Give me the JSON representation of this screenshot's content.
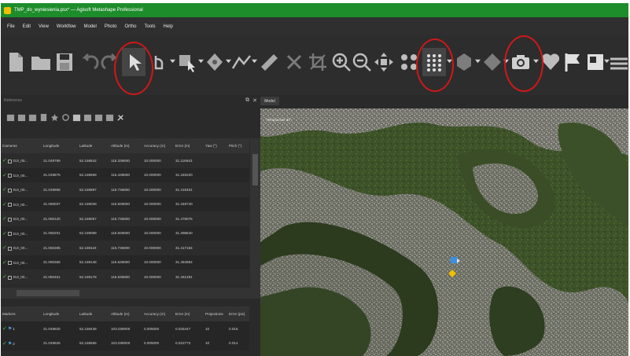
{
  "window": {
    "title": "TMP_do_wyniesienia.psx* — Agisoft Metashape Professional"
  },
  "menu": [
    "File",
    "Edit",
    "View",
    "Workflow",
    "Model",
    "Photo",
    "Ortho",
    "Tools",
    "Help"
  ],
  "toolbar": {
    "buttons": [
      {
        "name": "new-document-icon"
      },
      {
        "name": "open-folder-icon"
      },
      {
        "name": "save-icon"
      },
      {
        "name": "undo-icon"
      },
      {
        "name": "redo-icon"
      },
      {
        "name": "navigation-pointer-icon"
      },
      {
        "name": "rotate-object-icon"
      },
      {
        "name": "rectangle-selection-icon"
      },
      {
        "name": "draw-point-icon"
      },
      {
        "name": "draw-polyline-icon"
      },
      {
        "name": "ruler-icon"
      },
      {
        "name": "delete-selection-icon"
      },
      {
        "name": "crop-selection-icon"
      },
      {
        "name": "zoom-in-icon"
      },
      {
        "name": "zoom-out-icon"
      },
      {
        "name": "move-object-icon"
      },
      {
        "name": "tie-points-icon"
      },
      {
        "name": "dense-cloud-icon"
      },
      {
        "name": "model-shaded-icon"
      },
      {
        "name": "tiled-model-icon"
      },
      {
        "name": "show-cameras-icon"
      },
      {
        "name": "show-markers-icon"
      },
      {
        "name": "show-shapes-icon"
      },
      {
        "name": "show-images-icon"
      },
      {
        "name": "show-layers-icon"
      }
    ],
    "accent_circle_color": "#d01818"
  },
  "reference": {
    "panel_label": "Reference",
    "cameras": {
      "headers": [
        "Cameras",
        "Longitude",
        "Latitude",
        "Altitude (m)",
        "Accuracy (m)",
        "Error (m)",
        "Yaw (°)",
        "Pitch (°)"
      ],
      "rows": [
        {
          "label": "DJI_00...",
          "lon": "21.049799",
          "lat": "52.158642",
          "alt": "116.336800",
          "acc": "10.000000",
          "err": "31.116643"
        },
        {
          "label": "DJI_00...",
          "lon": "21.049875",
          "lat": "52.158669",
          "alt": "116.436800",
          "acc": "10.000000",
          "err": "31.345220"
        },
        {
          "label": "DJI_00...",
          "lon": "21.049958",
          "lat": "52.158997",
          "alt": "116.736800",
          "acc": "10.000000",
          "err": "31.416451"
        },
        {
          "label": "DJI_00...",
          "lon": "21.050037",
          "lat": "52.159028",
          "alt": "115.836800",
          "acc": "10.000000",
          "err": "31.348740"
        },
        {
          "label": "DJI_00...",
          "lon": "21.050120",
          "lat": "52.159057",
          "alt": "115.736800",
          "acc": "10.000000",
          "err": "31.478075"
        },
        {
          "label": "DJI_00...",
          "lon": "21.050201",
          "lat": "52.159089",
          "alt": "115.836800",
          "acc": "10.000000",
          "err": "31.398640"
        },
        {
          "label": "DJI_00...",
          "lon": "21.050285",
          "lat": "52.159119",
          "alt": "115.736800",
          "acc": "10.000000",
          "err": "31.417184"
        },
        {
          "label": "DJI_00...",
          "lon": "21.050366",
          "lat": "52.159148",
          "alt": "116.636800",
          "acc": "10.000000",
          "err": "31.484954"
        },
        {
          "label": "DJI_00...",
          "lon": "21.050451",
          "lat": "52.159178",
          "alt": "115.536800",
          "acc": "10.000000",
          "err": "31.461281"
        }
      ]
    },
    "markers": {
      "headers": [
        "Markers",
        "Longitude",
        "Latitude",
        "Altitude (m)",
        "Accuracy (m)",
        "Error (m)",
        "Projections",
        "Error (pix)"
      ],
      "rows": [
        {
          "label": "1",
          "lon": "21.049620",
          "lat": "52.159438",
          "alt": "103.039000",
          "acc": "0.005000",
          "err": "0.025447",
          "proj": "10",
          "errpix": "0.015"
        },
        {
          "label": "2",
          "lon": "21.049525",
          "lat": "52.159566",
          "alt": "103.039000",
          "acc": "0.005000",
          "err": "0.022773",
          "proj": "10",
          "errpix": "0.014"
        }
      ]
    }
  },
  "model": {
    "tab_label": "Model",
    "view_label": "Perspective 30°"
  }
}
